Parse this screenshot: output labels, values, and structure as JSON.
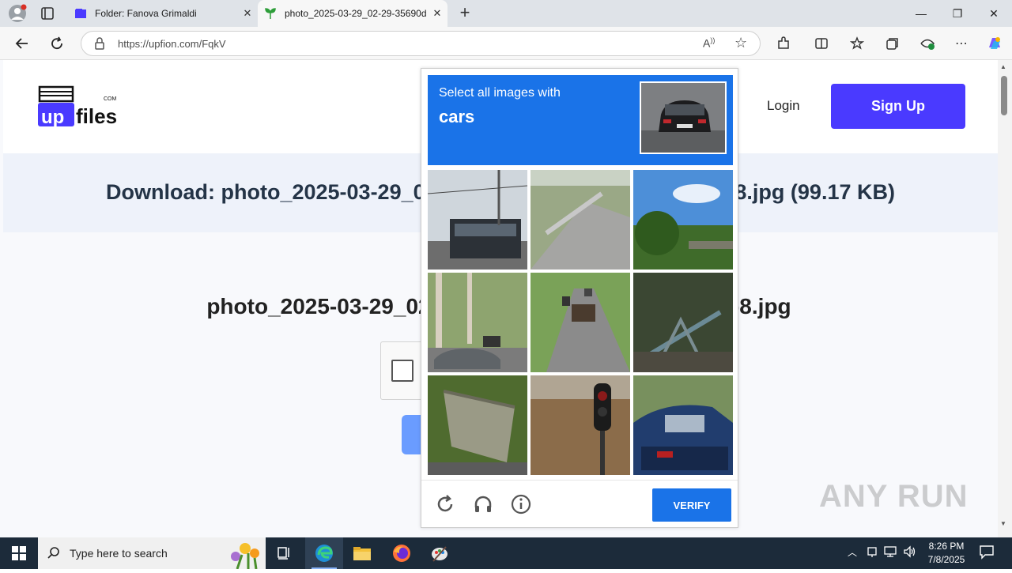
{
  "browser": {
    "tabs": [
      {
        "title": "Folder: Fanova Grimaldi",
        "icon": "upfiles-favicon"
      },
      {
        "title": "photo_2025-03-29_02-29-35690d",
        "icon": "leaf-favicon"
      }
    ],
    "url": "https://upfion.com/FqkV"
  },
  "site": {
    "logo_small": "COM",
    "logo_up": "up",
    "logo_files": "files",
    "login_label": "Login",
    "signup_label": "Sign Up",
    "download_title": "Download: photo_2025-03-29_02-29-35690d0a8a7b4f3a9c6e1b8.jpg (99.17 KB)",
    "filename": "photo_2025-03-29_02-29-35690d0a8a7b4f3a9c6e1b8.jpg"
  },
  "captcha": {
    "prompt_line1": "Select all images with",
    "prompt_target": "cars",
    "tiles": [
      "bus on street",
      "guardrail road",
      "trees and sky",
      "street with cars",
      "road with cars",
      "broken fence",
      "damaged sign",
      "traffic light",
      "parked car"
    ],
    "verify_label": "VERIFY"
  },
  "taskbar": {
    "search_placeholder": "Type here to search",
    "time": "8:26 PM",
    "date": "7/8/2025"
  },
  "watermark": "ANY RUN"
}
